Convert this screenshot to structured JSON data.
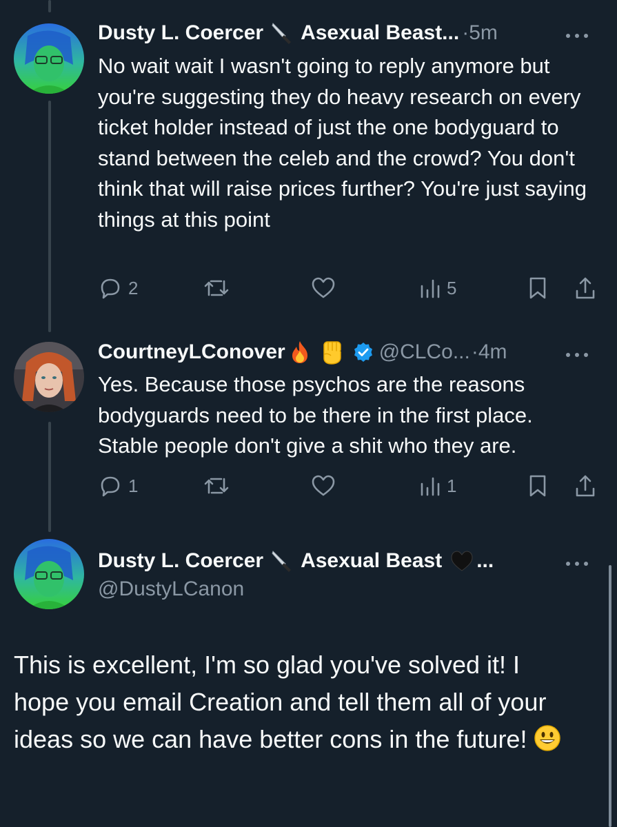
{
  "tweets": [
    {
      "display_name": "Dusty L. Coercer",
      "name_emoji": "🔪",
      "name_suffix": "Asexual Beast...",
      "separator": "·",
      "time": "5m",
      "text": "No wait wait I wasn't going to reply anymore but you're suggesting they do heavy research on every ticket holder instead of just the one bodyguard to stand between the celeb and the crowd? You don't think that will raise prices further? You're just saying things at this point",
      "reply_count": "2",
      "views_count": "5"
    },
    {
      "display_name": "CourtneyLConover",
      "name_emoji": "🔥 ✊",
      "verified": true,
      "handle": "@CLCo...",
      "separator": "·",
      "time": "4m",
      "text": "Yes.  Because those psychos are the reasons bodyguards need to be there in the first place.  Stable people don't give a shit who they are.",
      "reply_count": "1",
      "views_count": "1"
    }
  ],
  "main_tweet": {
    "display_name": "Dusty L. Coercer",
    "name_emoji": "🔪",
    "name_suffix": "Asexual Beast",
    "suffix_emoji": "🖤",
    "ellipsis": "...",
    "handle": "@DustyLCanon",
    "text": "This is excellent, I'm so glad you've solved it! I hope you email Creation and tell them all of your ideas so we can have better cons in the future!",
    "end_emoji": "😃"
  },
  "colors": {
    "background": "#15202b",
    "text": "#f7f9f9",
    "muted": "#8b98a5",
    "thread_line": "#38444d",
    "verified": "#1d9bf0"
  },
  "icons": {
    "more": "more-icon",
    "reply": "reply-icon",
    "retweet": "retweet-icon",
    "like": "heart-icon",
    "views": "views-icon",
    "bookmark": "bookmark-icon",
    "share": "share-icon"
  }
}
